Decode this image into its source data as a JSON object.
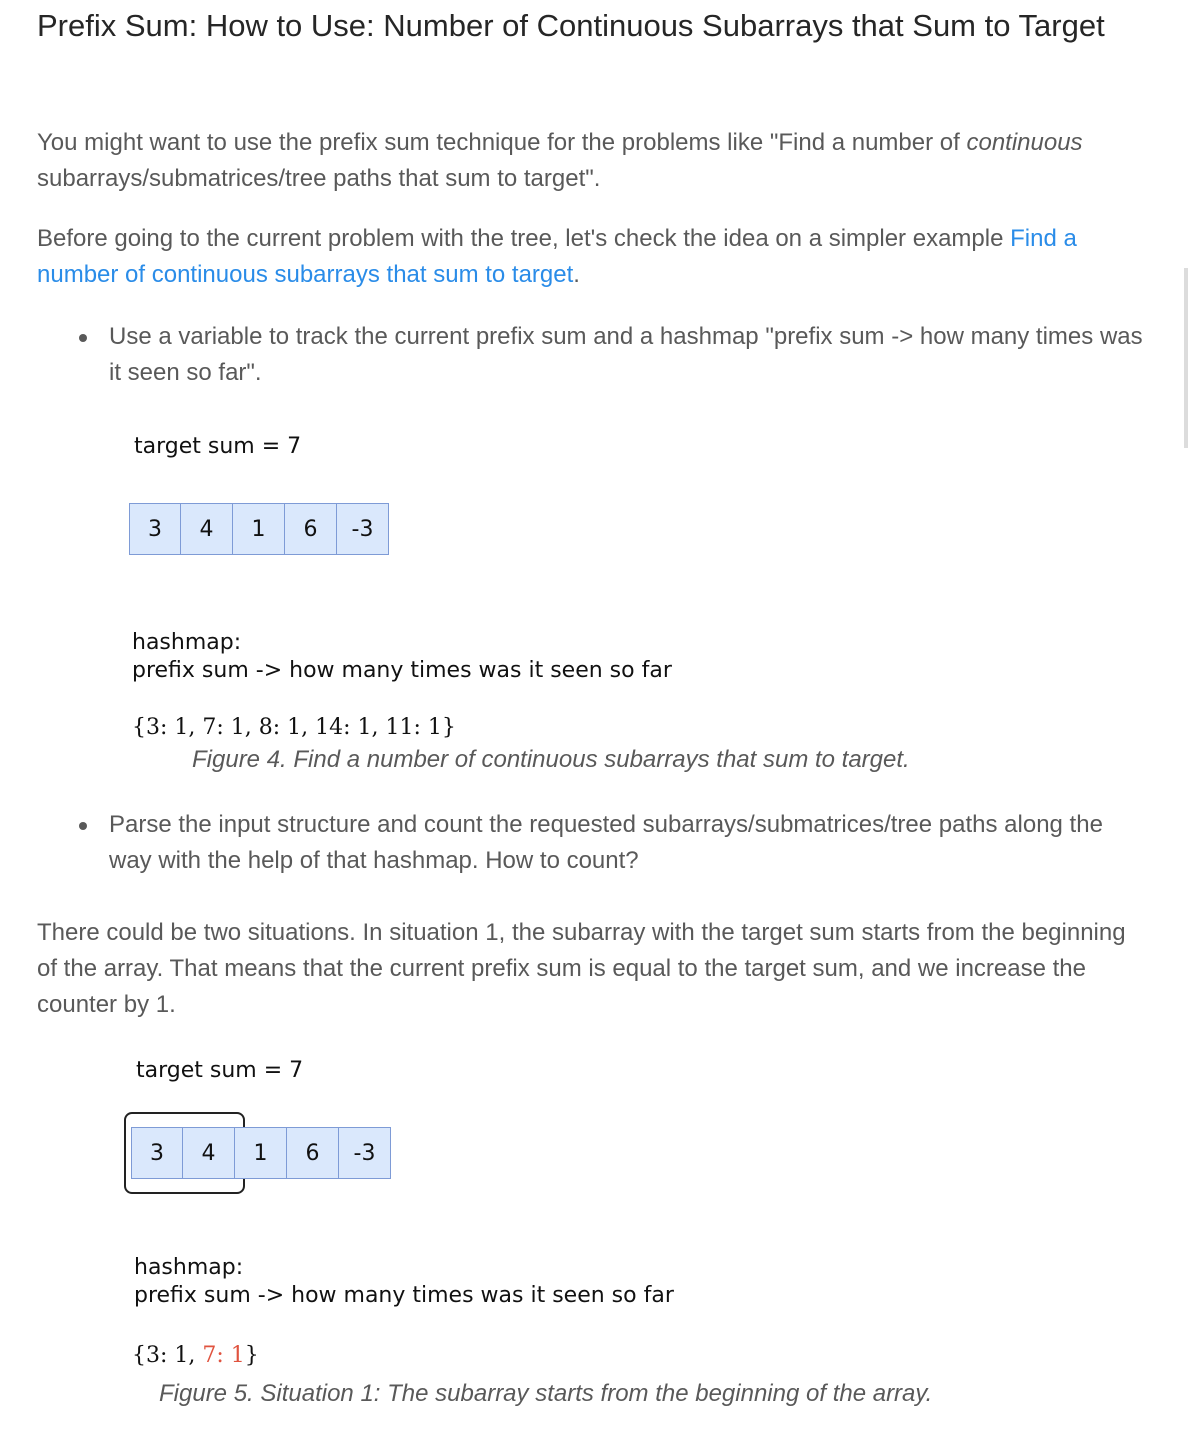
{
  "title": "Prefix Sum: How to Use: Number of Continuous Subarrays that Sum to Target",
  "intro": {
    "before": "You might want to use the prefix sum technique for the problems like \"Find a number of ",
    "emphasis": "continuous",
    "after": " subarrays/submatrices/tree paths that sum to target\"."
  },
  "before_problem": {
    "text": "Before going to the current problem with the tree, let's check the idea on a simpler example ",
    "link": "Find a number of continuous subarrays that sum to target",
    "end": "."
  },
  "bullets": [
    "Use a variable to track the current prefix sum and a hashmap \"prefix sum -> how many times was it seen so far\".",
    "Parse the input structure and count the requested subarrays/submatrices/tree paths along the way with the help of that hashmap. How to count?"
  ],
  "figure4": {
    "target_label": "target sum = 7",
    "array": [
      "3",
      "4",
      "1",
      "6",
      "-3"
    ],
    "hashmap_label": "hashmap:",
    "hashmap_desc": "prefix sum -> how many times was it seen so far",
    "hashmap_value": "{3: 1, 7: 1, 8: 1, 14: 1, 11: 1}",
    "caption": "Figure 4. Find a number of continuous subarrays that sum to target."
  },
  "situation_text": "There could be two situations. In situation 1, the subarray with the target sum starts from the beginning of the array. That means that the current prefix sum is equal to the target sum, and we increase the counter by 1.",
  "figure5": {
    "target_label": "target sum = 7",
    "array": [
      "3",
      "4",
      "1",
      "6",
      "-3"
    ],
    "hashmap_label": "hashmap:",
    "hashmap_desc": "prefix sum -> how many times was it seen so far",
    "hashmap_open": "{3: 1, ",
    "hashmap_highlight": "7: 1",
    "hashmap_close": "}",
    "caption": "Figure 5. Situation 1: The subarray starts from the beginning of the array."
  },
  "colors": {
    "text": "#595959",
    "heading": "#262626",
    "link": "#2a8ce8",
    "cell_fill": "#dae8fc",
    "cell_border": "#7e9bd6",
    "highlight": "#e0533f"
  }
}
